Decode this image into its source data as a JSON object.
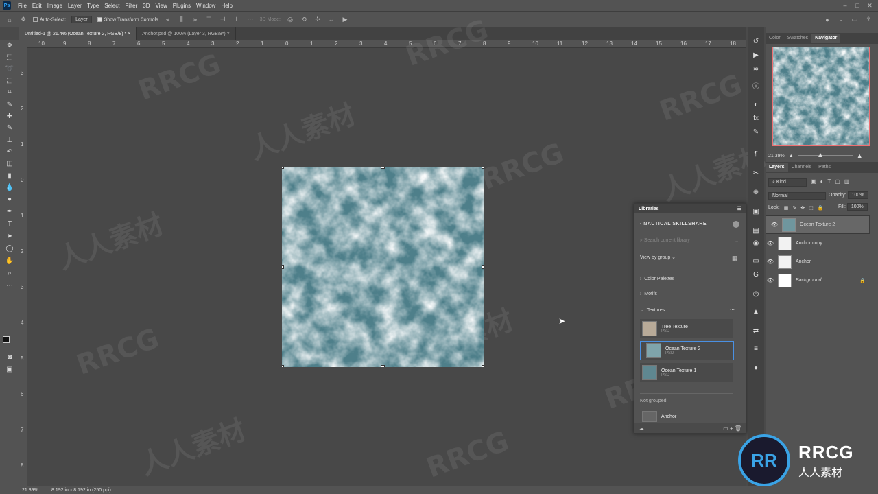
{
  "menubar": {
    "logo": "Ps",
    "items": [
      "File",
      "Edit",
      "Image",
      "Layer",
      "Type",
      "Select",
      "Filter",
      "3D",
      "View",
      "Plugins",
      "Window",
      "Help"
    ]
  },
  "options": {
    "auto_select_label": "Auto-Select:",
    "auto_select_value": "Layer",
    "show_transform_label": "Show Transform Controls",
    "mode_3d_label": "3D Mode:"
  },
  "tabs": [
    {
      "label": "Untitled-1 @ 21.4% (Ocean Texture 2, RGB/8) *",
      "active": true
    },
    {
      "label": "Anchor.psd @ 100% (Layer 3, RGB/8*)",
      "active": false
    }
  ],
  "ruler_h": [
    "10",
    "9",
    "8",
    "7",
    "6",
    "5",
    "4",
    "3",
    "2",
    "1",
    "0",
    "1",
    "2",
    "3",
    "4",
    "5",
    "6",
    "7",
    "8",
    "9",
    "10",
    "11",
    "12",
    "13",
    "14",
    "15",
    "16",
    "17",
    "18"
  ],
  "ruler_v": [
    "3",
    "2",
    "1",
    "0",
    "1",
    "2",
    "3",
    "4",
    "5",
    "6",
    "7",
    "8"
  ],
  "status": {
    "zoom": "21.39%",
    "size": "8.192 in x 8.192 in (250 ppi)"
  },
  "navigator": {
    "tabs": [
      "Color",
      "Swatches",
      "Navigator"
    ],
    "zoom": "21.39%"
  },
  "layers": {
    "tabs": [
      "Layers",
      "Channels",
      "Paths"
    ],
    "filter_kind": "Kind",
    "blend_mode": "Normal",
    "opacity_label": "Opacity:",
    "opacity_value": "100%",
    "lock_label": "Lock:",
    "fill_label": "Fill:",
    "fill_value": "100%",
    "rows": [
      {
        "name": "Ocean Texture 2",
        "selected": true
      },
      {
        "name": "Anchor copy",
        "selected": false
      },
      {
        "name": "Anchor",
        "selected": false
      },
      {
        "name": "Background",
        "selected": false
      }
    ]
  },
  "libraries": {
    "title": "Libraries",
    "library_name": "NAUTICAL SKILLSHARE",
    "search_placeholder": "Search current library",
    "view_by": "View by group",
    "groups": [
      "Color Palettes",
      "Motifs",
      "Textures"
    ],
    "items": [
      {
        "name": "Tree Texture",
        "type": "PSD"
      },
      {
        "name": "Ocean Texture 2",
        "type": "PSD"
      },
      {
        "name": "Ocean Texture 1",
        "type": "PSD"
      }
    ],
    "not_grouped_label": "Not grouped",
    "ungrouped_item": "Anchor"
  },
  "watermark": {
    "text_en": "RRCG",
    "text_cn": "人人素材"
  },
  "logo": {
    "mark": "RR",
    "line1": "RRCG",
    "line2": "人人素材"
  },
  "colors": {
    "accent": "#31a8ff",
    "selection": "#4a90e2",
    "nav_frame": "#ee6f72"
  }
}
